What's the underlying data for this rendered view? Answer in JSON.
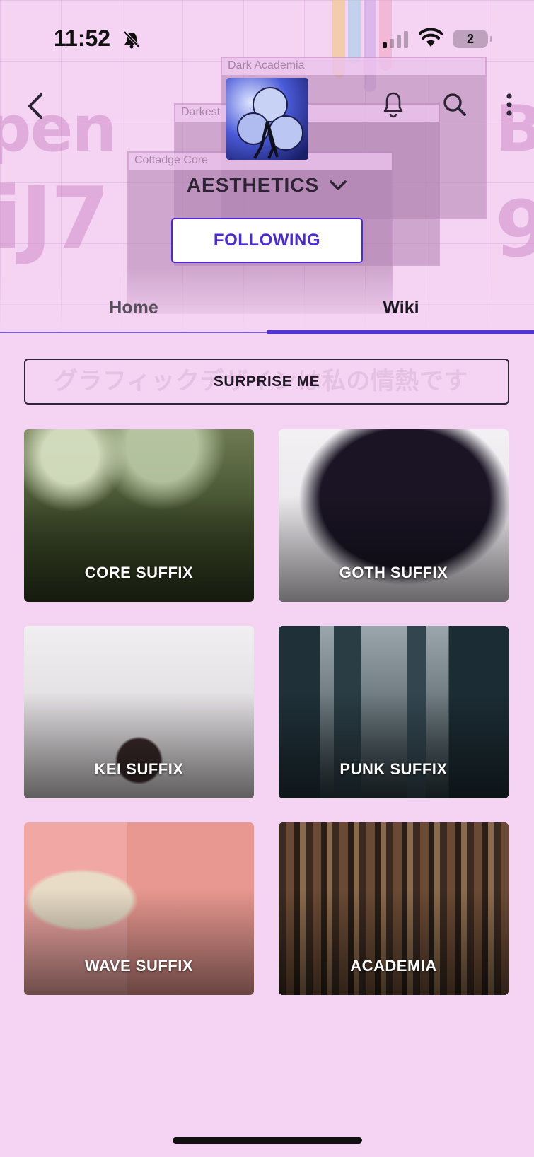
{
  "status_bar": {
    "time": "11:52",
    "battery_level": "2"
  },
  "background": {
    "window_titles": [
      "Dark Academia",
      "Darkest",
      "Cottadge Core"
    ]
  },
  "header": {
    "community_name": "AESTHETICS",
    "follow_label": "FOLLOWING",
    "icons": [
      "back-arrow-icon",
      "bell-icon",
      "search-icon",
      "more-vertical-icon",
      "chevron-down-icon"
    ]
  },
  "tabs": [
    {
      "label": "Home",
      "active": false
    },
    {
      "label": "Wiki",
      "active": true
    }
  ],
  "wiki": {
    "surprise_label": "SURPRISE ME",
    "surprise_bg_text": "グラフィックデザインは私の情熱です",
    "cards": [
      {
        "title": "CORE SUFFIX"
      },
      {
        "title": "GOTH SUFFIX"
      },
      {
        "title": "KEI SUFFIX"
      },
      {
        "title": "PUNK SUFFIX"
      },
      {
        "title": "WAVE SUFFIX"
      },
      {
        "title": "ACADEMIA"
      }
    ]
  },
  "colors": {
    "background": "#f5d3f3",
    "accent": "#4c2ad6",
    "tab_indicator": "#5031e0"
  }
}
